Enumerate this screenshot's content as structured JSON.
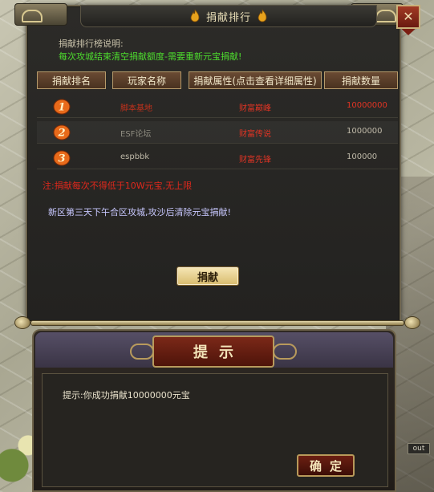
{
  "window": {
    "title": "捐献排行",
    "close_label": "✕"
  },
  "description": {
    "title": "捐献排行榜说明:",
    "text": "每次攻城结束清空捐献额度-需要重新元宝捐献!"
  },
  "table": {
    "headers": [
      "捐献排名",
      "玩家名称",
      "捐献属性(点击查看详细属性)",
      "捐献数量"
    ],
    "rows": [
      {
        "rank": "1",
        "name": "脚本基地",
        "attribute": "财富巅峰",
        "amount": "10000000"
      },
      {
        "rank": "2",
        "name": "ESF论坛",
        "attribute": "财富传说",
        "amount": "1000000"
      },
      {
        "rank": "3",
        "name": "espbbk",
        "attribute": "财富先锋",
        "amount": "100000"
      }
    ]
  },
  "notes": {
    "red": "注:捐献每次不得低于10W元宝,无上限",
    "blue": "新区第三天下午合区攻城,攻沙后清除元宝捐献!"
  },
  "donate_button": "捐献",
  "tip_dialog": {
    "title": "提示",
    "message": "提示:你成功捐献10000000元宝",
    "confirm_label": "确定"
  },
  "out_button": "out",
  "colors": {
    "panel_bg": "#2c2b28",
    "green_text": "#4ddc2e",
    "red_text": "#e03424",
    "header_btn": "#6a4b33",
    "rank_badge": "#e86a1a"
  }
}
